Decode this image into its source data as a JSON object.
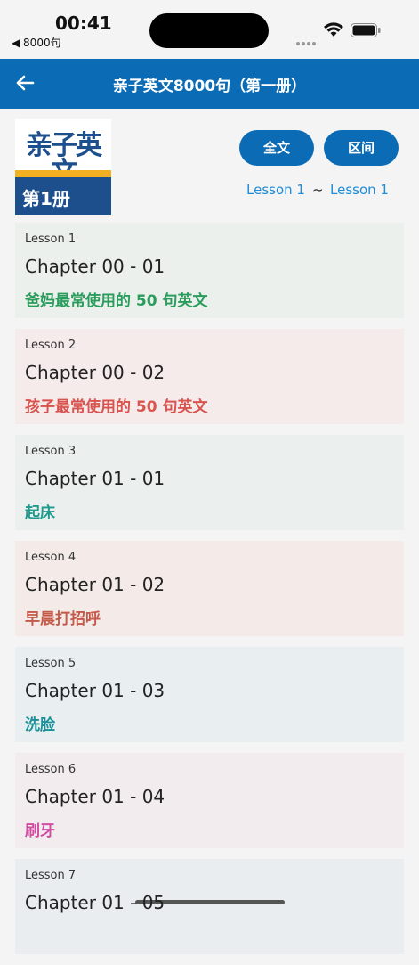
{
  "status": {
    "time": "00:41",
    "back_app": "◀ 8000句"
  },
  "header": {
    "title": "亲子英文8000句（第一册）"
  },
  "book": {
    "title": "亲子英文",
    "volume": "第1册"
  },
  "buttons": {
    "full_text": "全文",
    "range": "区间"
  },
  "range": {
    "start": "Lesson 1",
    "separator": "~",
    "end": "Lesson 1"
  },
  "lessons": [
    {
      "lesson": "Lesson 1",
      "chapter": "Chapter 00 - 01",
      "subtitle": "爸妈最常使用的 50 句英文",
      "bg": "#ebf0ec",
      "color": "#2a9c5c"
    },
    {
      "lesson": "Lesson 2",
      "chapter": "Chapter 00 - 02",
      "subtitle": "孩子最常使用的 50 句英文",
      "bg": "#f5ebea",
      "color": "#d9534f"
    },
    {
      "lesson": "Lesson 3",
      "chapter": "Chapter 01 - 01",
      "subtitle": "起床",
      "bg": "#ebf0ee",
      "color": "#1f9a8e"
    },
    {
      "lesson": "Lesson 4",
      "chapter": "Chapter 01 - 02",
      "subtitle": "早晨打招呼",
      "bg": "#f4ebe9",
      "color": "#c45a4a"
    },
    {
      "lesson": "Lesson 5",
      "chapter": "Chapter 01 - 03",
      "subtitle": "洗脸",
      "bg": "#e9eff0",
      "color": "#1a8f97"
    },
    {
      "lesson": "Lesson 6",
      "chapter": "Chapter 01 - 04",
      "subtitle": "刷牙",
      "bg": "#f3ecee",
      "color": "#d04ea1"
    },
    {
      "lesson": "Lesson 7",
      "chapter": "Chapter 01 - 05",
      "subtitle": "",
      "bg": "#eaedef",
      "color": "#333333"
    }
  ]
}
